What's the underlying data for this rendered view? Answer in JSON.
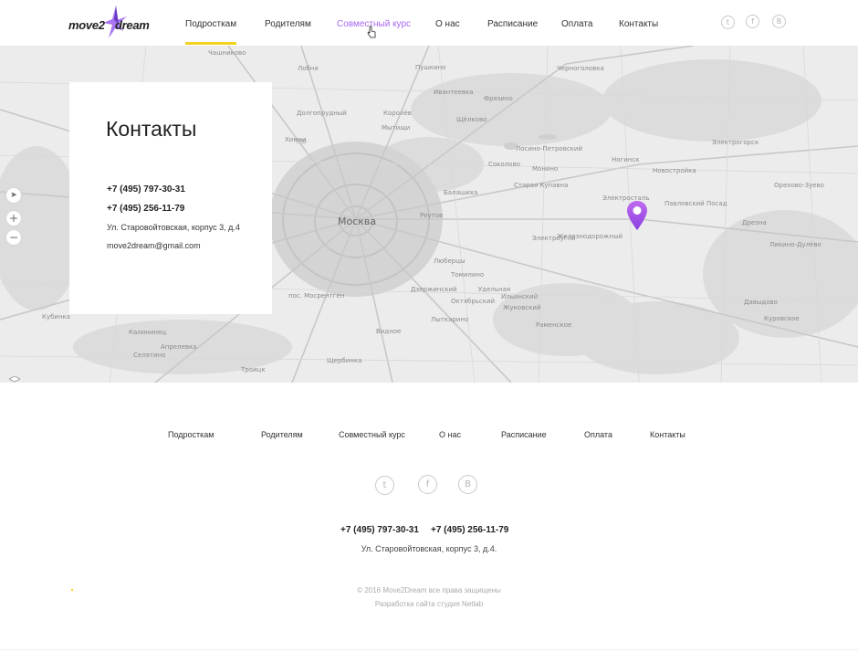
{
  "logo": {
    "part1": "move2",
    "part2": "dream"
  },
  "nav": [
    {
      "label": "Подросткам"
    },
    {
      "label": "Родителям"
    },
    {
      "label": "Совместный курс"
    },
    {
      "label": "О нас"
    },
    {
      "label": "Расписание"
    },
    {
      "label": "Оплата"
    },
    {
      "label": "Контакты"
    }
  ],
  "social": [
    {
      "icon": "twitter-icon",
      "glyph": "t"
    },
    {
      "icon": "facebook-icon",
      "glyph": "f"
    },
    {
      "icon": "vk-icon",
      "glyph": "B"
    }
  ],
  "map": {
    "city": "Москва",
    "places": [
      "Чашниково",
      "Лобня",
      "Пушкино",
      "Черноголовка",
      "Ивантеевка",
      "Фрязино",
      "Долгопрудный",
      "Королёв",
      "Щёлково",
      "Химки",
      "Мытищи",
      "Лосино-Петровский",
      "Соколово",
      "Монино",
      "Ногинск",
      "Новостройка",
      "Электрогорск",
      "Балашиха",
      "Старая Купавна",
      "Электросталь",
      "Павловский Посад",
      "Орехово-Зуево",
      "Реутов",
      "Железнодорожный",
      "Дрезна",
      "Ликино-Дулёво",
      "Люберцы",
      "Электроугли",
      "Томилино",
      "Дзержинский",
      "Удельная",
      "Ильинский",
      "Жуковский",
      "Раменское",
      "Октябрьский",
      "Лыткарино",
      "Видное",
      "пос. Мосрентген",
      "Калининец",
      "Апрелевка",
      "Селятино",
      "Троицк",
      "Щербинка",
      "Кубинка",
      "Давыдово",
      "Куровское"
    ]
  },
  "map_controls": {
    "locate": "➤",
    "zoom_in": "+",
    "zoom_out": "−"
  },
  "card": {
    "title": "Контакты",
    "phone1": "+7 (495) 797-30-31",
    "phone2": "+7 (495) 256-11-79",
    "address": "Ул. Старовойтовская, корпус 3, д.4",
    "email": "move2dream@gmail.com"
  },
  "footer": {
    "nav": [
      {
        "label": "Подросткам"
      },
      {
        "label": "Родителям"
      },
      {
        "label": "Совместный курс"
      },
      {
        "label": "О нас"
      },
      {
        "label": "Расписание"
      },
      {
        "label": "Оплата"
      },
      {
        "label": "Контакты"
      }
    ],
    "phone1": "+7 (495) 797-30-31",
    "phone2": "+7 (495) 256-11-79",
    "address": "Ул. Старовойтовская, корпус 3, д.4.",
    "copyright": "© 2016 Move2Dream все права защищены",
    "developer": "Разработка сайта студия Netlab"
  },
  "colors": {
    "accent_yellow": "#f2d21f",
    "accent_purple": "#a868f0",
    "map_bg": "#ececec"
  }
}
